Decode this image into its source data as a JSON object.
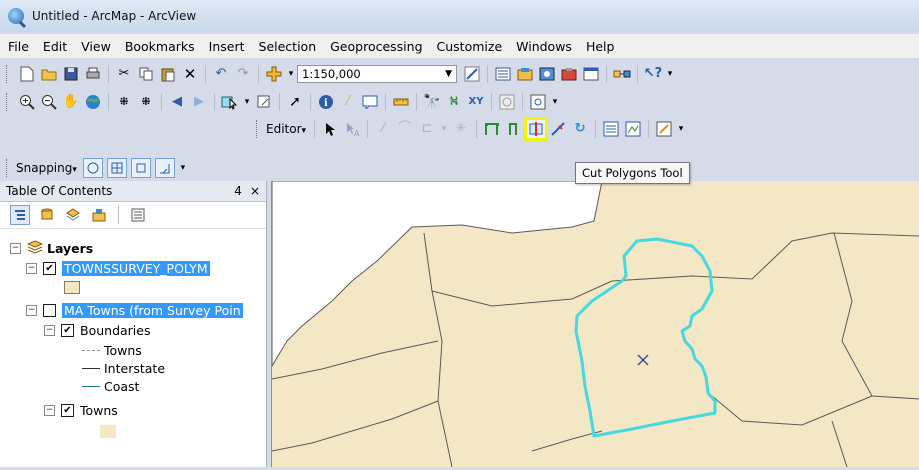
{
  "window": {
    "title": "Untitled - ArcMap - ArcView",
    "app_icon": "arcmap-globe-icon"
  },
  "menu": [
    "File",
    "Edit",
    "View",
    "Bookmarks",
    "Insert",
    "Selection",
    "Geoprocessing",
    "Customize",
    "Windows",
    "Help"
  ],
  "standard_toolbar": {
    "scale": "1:150,000",
    "icons": [
      "new-document-icon",
      "open-icon",
      "save-icon",
      "print-icon",
      "cut-icon",
      "copy-icon",
      "paste-icon",
      "delete-icon",
      "undo-icon",
      "redo-icon",
      "add-data-icon",
      "editor-toolbar-icon",
      "table-of-contents-icon",
      "catalog-icon",
      "search-icon",
      "arctoolbox-icon",
      "python-icon",
      "model-builder-icon",
      "whats-this-icon"
    ]
  },
  "tools_toolbar": {
    "icons": [
      "zoom-in-icon",
      "zoom-out-icon",
      "pan-icon",
      "full-extent-icon",
      "fixed-zoom-in-icon",
      "fixed-zoom-out-icon",
      "back-extent-icon",
      "forward-extent-icon",
      "select-features-icon",
      "clear-selection-icon",
      "select-elements-icon",
      "identify-icon",
      "html-popup-icon",
      "hyperlink-icon",
      "measure-icon",
      "find-icon",
      "find-route-icon",
      "go-to-xy-icon",
      "time-slider-icon",
      "create-viewer-window-icon"
    ]
  },
  "editor_toolbar": {
    "editor_label": "Editor",
    "highlighted_tool": "cut-polygons-tool",
    "tooltip": "Cut Polygons Tool"
  },
  "snapping_toolbar": {
    "label": "Snapping"
  },
  "toc": {
    "title": "Table Of Contents",
    "pin": "4",
    "close": "×",
    "root": "Layers",
    "layers": [
      {
        "name": "TOWNSSURVEY_POLYM",
        "checked": true,
        "selected": true
      },
      {
        "name": "MA Towns (from Survey Poin",
        "checked": false,
        "selected": true
      }
    ],
    "boundaries": {
      "label": "Boundaries",
      "legend": [
        "Towns",
        "Interstate",
        "Coast"
      ]
    },
    "towns": "Towns"
  },
  "colors": {
    "land": "#f4e7c6",
    "boundary": "#5a5a5a",
    "selection": "#44d9e0",
    "highlight": "#f2f21a",
    "toc_selected": "#3399ff"
  }
}
